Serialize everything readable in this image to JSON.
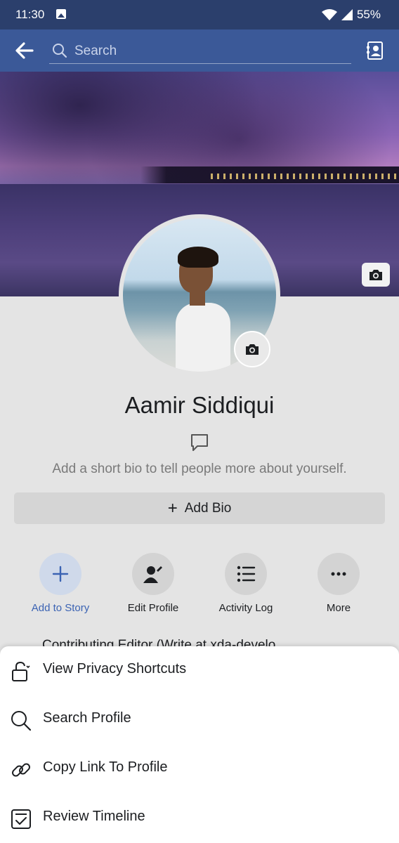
{
  "status_bar": {
    "time": "11:30",
    "battery": "55%"
  },
  "app_bar": {
    "search_placeholder": "Search"
  },
  "profile": {
    "name": "Aamir Siddiqui",
    "bio_hint": "Add a short bio to tell people more about yourself.",
    "add_bio_label": "Add Bio"
  },
  "actions": [
    {
      "label": "Add to Story",
      "icon": "plus-icon"
    },
    {
      "label": "Edit Profile",
      "icon": "edit-person-icon"
    },
    {
      "label": "Activity Log",
      "icon": "list-icon"
    },
    {
      "label": "More",
      "icon": "more-icon"
    }
  ],
  "peek_row_text": "Contributing Editor (Write at xda-develo",
  "sheet": {
    "items": [
      {
        "label": "View Privacy Shortcuts",
        "icon": "lock-icon"
      },
      {
        "label": "Search Profile",
        "icon": "search-icon"
      },
      {
        "label": "Copy Link To Profile",
        "icon": "link-icon"
      },
      {
        "label": "Review Timeline",
        "icon": "timeline-review-icon"
      }
    ]
  },
  "colors": {
    "status_bar": "#2b3f6c",
    "app_bar": "#3b5998",
    "accent": "#3b63b3"
  }
}
